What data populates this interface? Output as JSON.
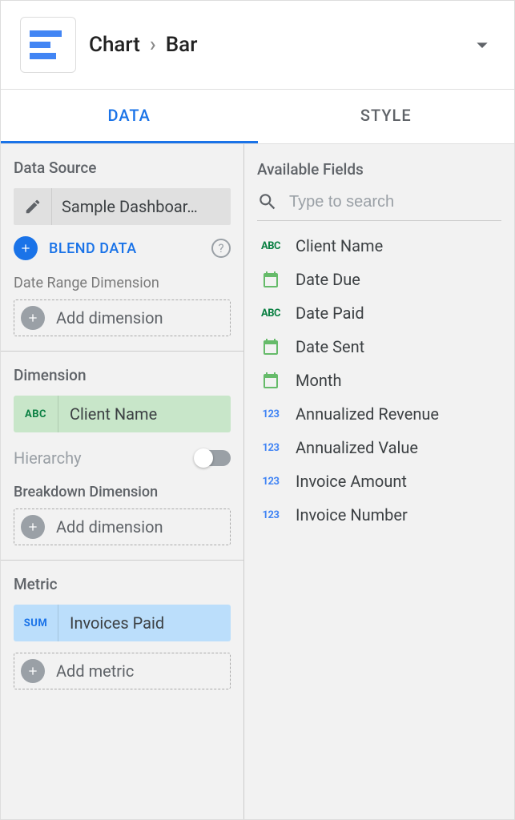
{
  "header": {
    "parent": "Chart",
    "current": "Bar"
  },
  "tabs": {
    "data": "DATA",
    "style": "STYLE"
  },
  "data_source": {
    "section_title": "Data Source",
    "name": "Sample Dashboar…",
    "blend_label": "BLEND DATA"
  },
  "date_range": {
    "section_title": "Date Range Dimension",
    "add_label": "Add dimension"
  },
  "dimension": {
    "section_title": "Dimension",
    "chip_type": "ABC",
    "chip_label": "Client Name",
    "hierarchy_label": "Hierarchy",
    "breakdown_title": "Breakdown Dimension",
    "add_label": "Add dimension"
  },
  "metric": {
    "section_title": "Metric",
    "chip_type": "SUM",
    "chip_label": "Invoices Paid",
    "add_label": "Add metric"
  },
  "available_fields": {
    "title": "Available Fields",
    "search_placeholder": "Type to search",
    "items": [
      {
        "type": "abc",
        "label": "Client Name"
      },
      {
        "type": "date",
        "label": "Date Due"
      },
      {
        "type": "abc",
        "label": "Date Paid"
      },
      {
        "type": "date",
        "label": "Date Sent"
      },
      {
        "type": "date",
        "label": "Month"
      },
      {
        "type": "num",
        "label": "Annualized Revenue"
      },
      {
        "type": "num",
        "label": "Annualized Value"
      },
      {
        "type": "num",
        "label": "Invoice Amount"
      },
      {
        "type": "num",
        "label": "Invoice Number"
      }
    ]
  }
}
